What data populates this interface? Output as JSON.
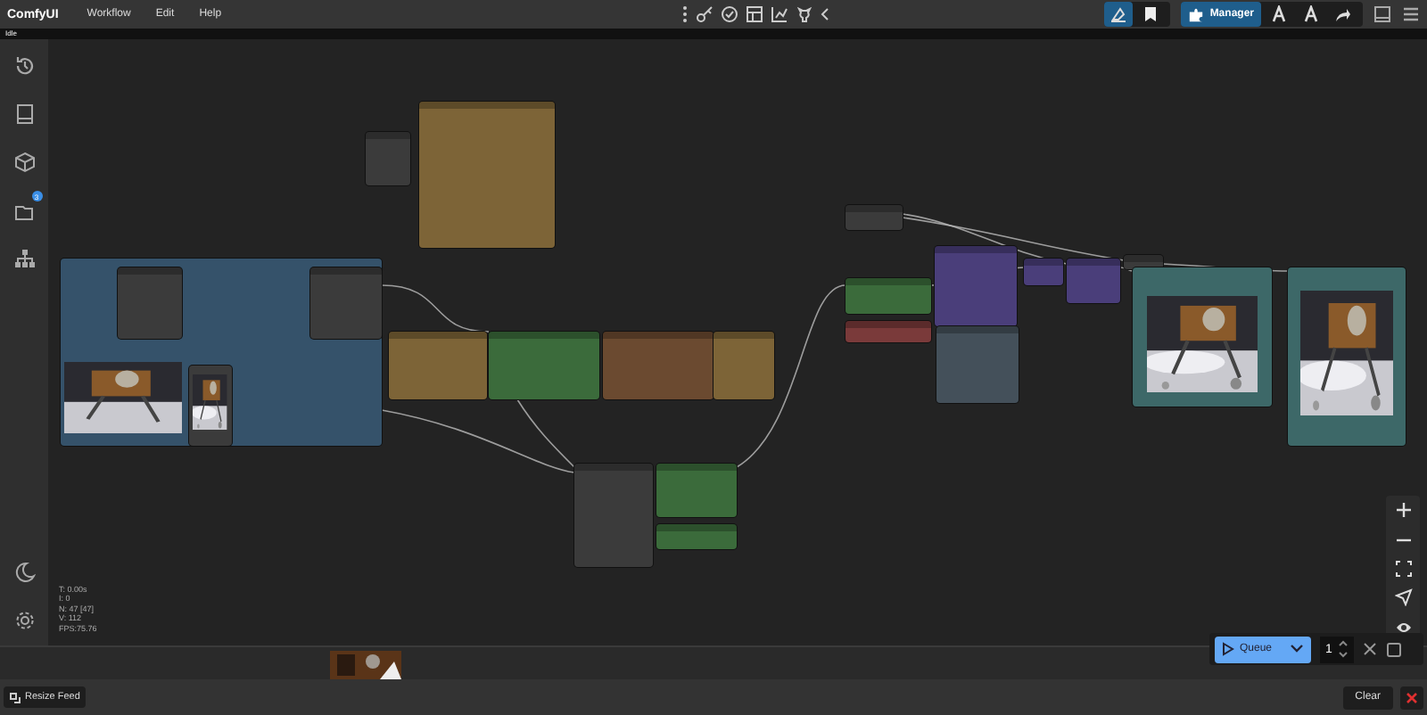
{
  "app": {
    "name": "ComfyUI"
  },
  "menu": [
    "Workflow",
    "Edit",
    "Help"
  ],
  "status": {
    "label": "Idle"
  },
  "toolbar": {
    "manager": "Manager",
    "toggles": [
      {
        "selected": true
      },
      {
        "selected": false
      }
    ]
  },
  "sidebar": {
    "badge": "3"
  },
  "stats": [
    "T: 0.00s",
    "I: 0",
    "N: 47 [47]",
    "V: 112",
    "FPS:75.76"
  ],
  "nodes": [
    {
      "color": "#35526a",
      "kind": "group"
    },
    {
      "color": "#3b3b3b",
      "kind": "node"
    },
    {
      "color": "#7d6437",
      "kind": "node"
    },
    {
      "color": "#7d6437",
      "kind": "node"
    },
    {
      "color": "#3b6b3b",
      "kind": "node"
    },
    {
      "color": "#6b4a30",
      "kind": "node"
    },
    {
      "color": "#7d6437",
      "kind": "node"
    },
    {
      "color": "#3b3b3b",
      "kind": "node"
    },
    {
      "color": "#3b6b3b",
      "kind": "node"
    },
    {
      "color": "#3b6b3b",
      "kind": "node"
    },
    {
      "color": "#3b3b3b",
      "kind": "node"
    },
    {
      "color": "#3b6b3b",
      "kind": "node"
    },
    {
      "color": "#7a3a3a",
      "kind": "node"
    },
    {
      "color": "#4a3e7a",
      "kind": "node"
    },
    {
      "color": "#44505a",
      "kind": "node"
    },
    {
      "color": "#4a3e7a",
      "kind": "node"
    },
    {
      "color": "#4a3e7a",
      "kind": "node"
    },
    {
      "color": "#3b3b3b",
      "kind": "node"
    },
    {
      "color": "#3d6868",
      "kind": "preview"
    },
    {
      "color": "#3d6868",
      "kind": "preview"
    },
    {
      "color": "#3b3b3b",
      "kind": "node"
    },
    {
      "color": "#3b3b3b",
      "kind": "node"
    },
    {
      "color": "#3b3b3b",
      "kind": "preview"
    }
  ],
  "queue": {
    "label": "Queue",
    "count": "1"
  },
  "feed": {
    "resize": "Resize Feed",
    "clear": "Clear"
  }
}
